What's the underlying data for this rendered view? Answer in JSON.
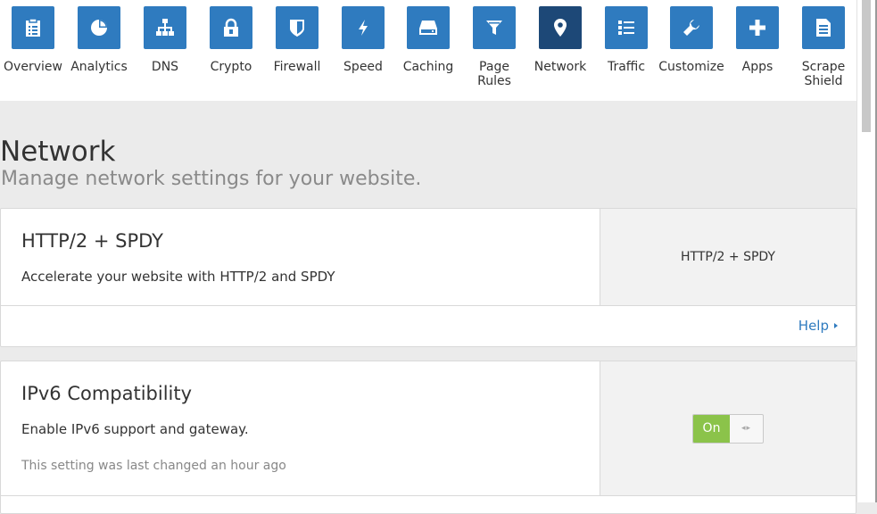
{
  "nav": {
    "items": [
      {
        "label": "Overview",
        "icon": "clipboard-icon",
        "active": false
      },
      {
        "label": "Analytics",
        "icon": "pie-chart-icon",
        "active": false
      },
      {
        "label": "DNS",
        "icon": "sitemap-icon",
        "active": false
      },
      {
        "label": "Crypto",
        "icon": "lock-icon",
        "active": false
      },
      {
        "label": "Firewall",
        "icon": "shield-icon",
        "active": false
      },
      {
        "label": "Speed",
        "icon": "lightning-icon",
        "active": false
      },
      {
        "label": "Caching",
        "icon": "server-icon",
        "active": false
      },
      {
        "label": "Page\nRules",
        "icon": "filter-icon",
        "active": false
      },
      {
        "label": "Network",
        "icon": "location-pin-icon",
        "active": true
      },
      {
        "label": "Traffic",
        "icon": "list-icon",
        "active": false
      },
      {
        "label": "Customize",
        "icon": "wrench-icon",
        "active": false
      },
      {
        "label": "Apps",
        "icon": "plus-icon",
        "active": false
      },
      {
        "label": "Scrape\nShield",
        "icon": "document-icon",
        "active": false
      }
    ]
  },
  "page": {
    "title": "Network",
    "subtitle": "Manage network settings for your website."
  },
  "cards": {
    "http2": {
      "title": "HTTP/2 + SPDY",
      "description": "Accelerate your website with HTTP/2 and SPDY",
      "side_value": "HTTP/2 + SPDY",
      "help_label": "Help"
    },
    "ipv6": {
      "title": "IPv6 Compatibility",
      "description": "Enable IPv6 support and gateway.",
      "last_changed": "This setting was last changed an hour ago",
      "toggle_label": "On",
      "toggle_state": "on"
    }
  },
  "colors": {
    "nav_tile": "#2f7bbf",
    "nav_tile_active": "#1d4877",
    "toggle_on": "#8bc34a",
    "link": "#2f7bbf"
  }
}
